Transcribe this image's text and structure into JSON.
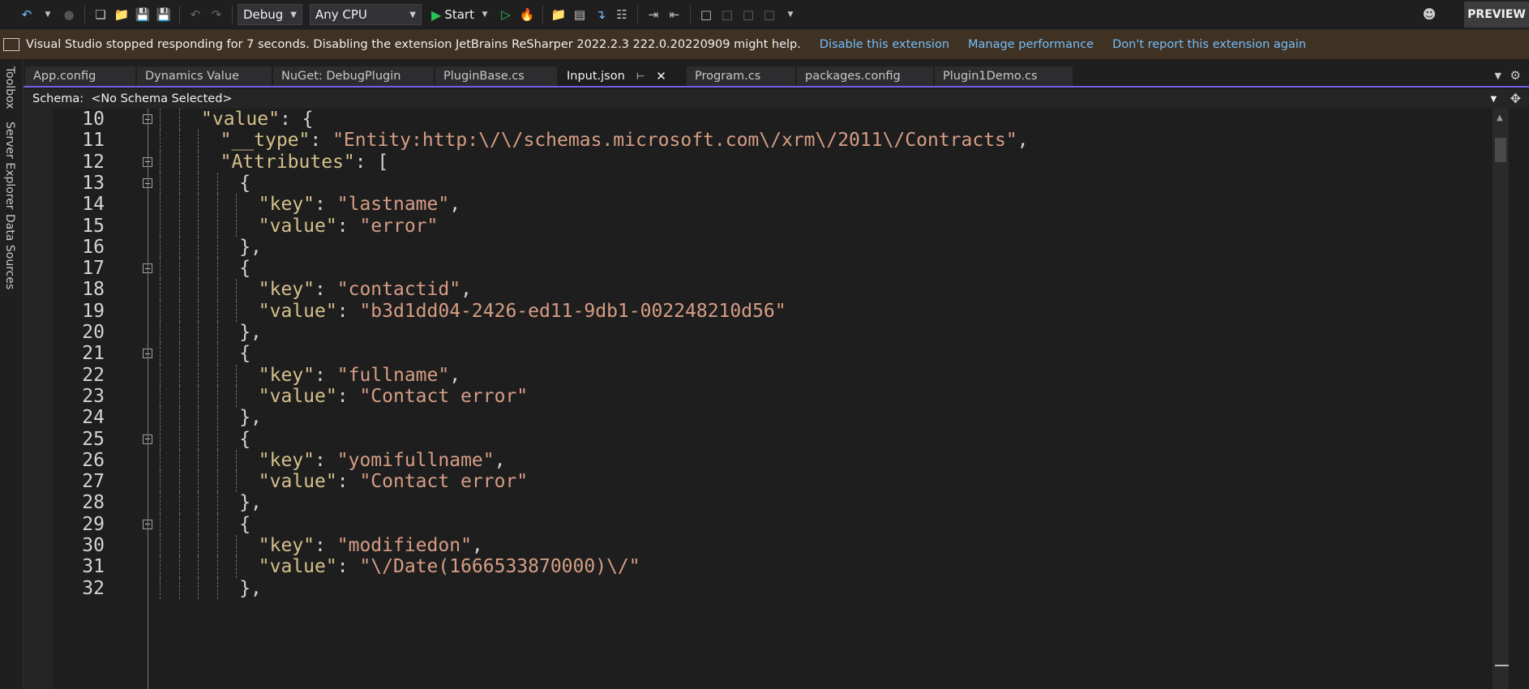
{
  "toolbar": {
    "config": "Debug",
    "platform": "Any CPU",
    "start_label": "Start",
    "preview_label": "PREVIEW"
  },
  "infobar": {
    "message": "Visual Studio stopped responding for 7 seconds. Disabling the extension JetBrains ReSharper 2022.2.3 222.0.20220909 might help.",
    "links": [
      "Disable this extension",
      "Manage performance",
      "Don't report this extension again"
    ]
  },
  "side_tabs": [
    "Toolbox",
    "Server Explorer",
    "Data Sources"
  ],
  "tabs": [
    {
      "label": "App.config"
    },
    {
      "label": "Dynamics Value"
    },
    {
      "label": "NuGet: DebugPlugin"
    },
    {
      "label": "PluginBase.cs"
    },
    {
      "label": "Input.json",
      "active": true
    },
    {
      "label": "Program.cs"
    },
    {
      "label": "packages.config"
    },
    {
      "label": "Plugin1Demo.cs"
    }
  ],
  "schema": {
    "label": "Schema:",
    "value": "<No Schema Selected>"
  },
  "code_lines": [
    {
      "n": "10",
      "fold": true,
      "indent": 2,
      "tokens": [
        [
          "prop",
          "\"value\""
        ],
        [
          "punc",
          ": {"
        ]
      ]
    },
    {
      "n": "11",
      "fold": false,
      "indent": 3,
      "tokens": [
        [
          "prop",
          "\"__type\""
        ],
        [
          "punc",
          ": "
        ],
        [
          "str",
          "\"Entity:http:\\/\\/schemas.microsoft.com\\/xrm\\/2011\\/Contracts\""
        ],
        [
          "punc",
          ","
        ]
      ]
    },
    {
      "n": "12",
      "fold": true,
      "indent": 3,
      "tokens": [
        [
          "prop",
          "\"Attributes\""
        ],
        [
          "punc",
          ": ["
        ]
      ]
    },
    {
      "n": "13",
      "fold": true,
      "indent": 4,
      "tokens": [
        [
          "punc",
          "{"
        ]
      ]
    },
    {
      "n": "14",
      "fold": false,
      "indent": 5,
      "tokens": [
        [
          "prop",
          "\"key\""
        ],
        [
          "punc",
          ": "
        ],
        [
          "str",
          "\"lastname\""
        ],
        [
          "punc",
          ","
        ]
      ]
    },
    {
      "n": "15",
      "fold": false,
      "indent": 5,
      "tokens": [
        [
          "prop",
          "\"value\""
        ],
        [
          "punc",
          ": "
        ],
        [
          "str",
          "\"error\""
        ]
      ]
    },
    {
      "n": "16",
      "fold": false,
      "indent": 4,
      "tokens": [
        [
          "punc",
          "},"
        ]
      ]
    },
    {
      "n": "17",
      "fold": true,
      "indent": 4,
      "tokens": [
        [
          "punc",
          "{"
        ]
      ]
    },
    {
      "n": "18",
      "fold": false,
      "indent": 5,
      "tokens": [
        [
          "prop",
          "\"key\""
        ],
        [
          "punc",
          ": "
        ],
        [
          "str",
          "\"contactid\""
        ],
        [
          "punc",
          ","
        ]
      ]
    },
    {
      "n": "19",
      "fold": false,
      "indent": 5,
      "tokens": [
        [
          "prop",
          "\"value\""
        ],
        [
          "punc",
          ": "
        ],
        [
          "str",
          "\"b3d1dd04-2426-ed11-9db1-002248210d56\""
        ]
      ]
    },
    {
      "n": "20",
      "fold": false,
      "indent": 4,
      "tokens": [
        [
          "punc",
          "},"
        ]
      ]
    },
    {
      "n": "21",
      "fold": true,
      "indent": 4,
      "tokens": [
        [
          "punc",
          "{"
        ]
      ]
    },
    {
      "n": "22",
      "fold": false,
      "indent": 5,
      "tokens": [
        [
          "prop",
          "\"key\""
        ],
        [
          "punc",
          ": "
        ],
        [
          "str",
          "\"fullname\""
        ],
        [
          "punc",
          ","
        ]
      ]
    },
    {
      "n": "23",
      "fold": false,
      "indent": 5,
      "tokens": [
        [
          "prop",
          "\"value\""
        ],
        [
          "punc",
          ": "
        ],
        [
          "str",
          "\"Contact error\""
        ]
      ]
    },
    {
      "n": "24",
      "fold": false,
      "indent": 4,
      "tokens": [
        [
          "punc",
          "},"
        ]
      ]
    },
    {
      "n": "25",
      "fold": true,
      "indent": 4,
      "tokens": [
        [
          "punc",
          "{"
        ]
      ]
    },
    {
      "n": "26",
      "fold": false,
      "indent": 5,
      "tokens": [
        [
          "prop",
          "\"key\""
        ],
        [
          "punc",
          ": "
        ],
        [
          "str",
          "\"yomifullname\""
        ],
        [
          "punc",
          ","
        ]
      ]
    },
    {
      "n": "27",
      "fold": false,
      "indent": 5,
      "tokens": [
        [
          "prop",
          "\"value\""
        ],
        [
          "punc",
          ": "
        ],
        [
          "str",
          "\"Contact error\""
        ]
      ]
    },
    {
      "n": "28",
      "fold": false,
      "indent": 4,
      "tokens": [
        [
          "punc",
          "},"
        ]
      ]
    },
    {
      "n": "29",
      "fold": true,
      "indent": 4,
      "tokens": [
        [
          "punc",
          "{"
        ]
      ]
    },
    {
      "n": "30",
      "fold": false,
      "indent": 5,
      "tokens": [
        [
          "prop",
          "\"key\""
        ],
        [
          "punc",
          ": "
        ],
        [
          "str",
          "\"modifiedon\""
        ],
        [
          "punc",
          ","
        ]
      ]
    },
    {
      "n": "31",
      "fold": false,
      "indent": 5,
      "tokens": [
        [
          "prop",
          "\"value\""
        ],
        [
          "punc",
          ": "
        ],
        [
          "str",
          "\"\\/Date(1666533870000)\\/\""
        ]
      ]
    },
    {
      "n": "32",
      "fold": false,
      "indent": 4,
      "tokens": [
        [
          "punc",
          "},"
        ]
      ]
    }
  ]
}
